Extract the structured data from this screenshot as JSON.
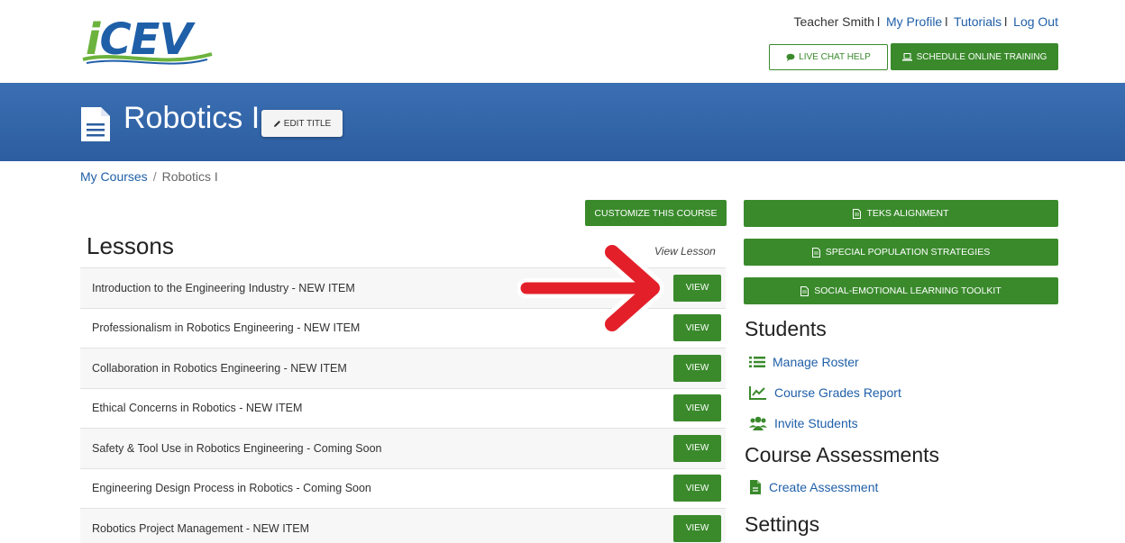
{
  "header": {
    "logo_text": "iCEV",
    "user_name": "Teacher Smith",
    "links": [
      "My Profile",
      "Tutorials",
      "Log Out"
    ],
    "separator": "l",
    "live_chat_label": "LIVE CHAT HELP",
    "schedule_training_label": "SCHEDULE ONLINE TRAINING"
  },
  "banner": {
    "course_title": "Robotics I",
    "edit_title_label": "EDIT TITLE"
  },
  "breadcrumb": {
    "root": "My Courses",
    "separator": "/",
    "current": "Robotics I"
  },
  "lessons": {
    "customize_label": "CUSTOMIZE THIS COURSE",
    "heading": "Lessons",
    "column_label": "View Lesson",
    "view_label": "VIEW",
    "items": [
      "Introduction to the Engineering Industry - NEW ITEM",
      "Professionalism in Robotics Engineering - NEW ITEM",
      "Collaboration in Robotics Engineering - NEW ITEM",
      "Ethical Concerns in Robotics - NEW ITEM",
      "Safety & Tool Use in Robotics Engineering - Coming Soon",
      "Engineering Design Process in Robotics - Coming Soon",
      "Robotics Project Management - NEW ITEM"
    ]
  },
  "sidebar": {
    "buttons": [
      "TEKS ALIGNMENT",
      "SPECIAL POPULATION STRATEGIES",
      "SOCIAL-EMOTIONAL LEARNING TOOLKIT"
    ],
    "students_heading": "Students",
    "student_links": [
      "Manage Roster",
      "Course Grades Report",
      "Invite Students"
    ],
    "assessments_heading": "Course Assessments",
    "assessment_links": [
      "Create Assessment"
    ],
    "settings_heading": "Settings"
  },
  "colors": {
    "brand_blue": "#1f5fa8",
    "brand_green": "#3a8a2c",
    "banner_blue": "#2c5da0",
    "annotation_arrow": "#e3202a"
  },
  "icons": {
    "chat": "chat-bubble-icon",
    "training": "laptop-icon",
    "document": "document-icon",
    "edit": "pencil-icon",
    "file": "file-icon",
    "roster": "list-icon",
    "grades": "line-chart-icon",
    "invite": "users-icon",
    "create": "file-plus-icon"
  }
}
